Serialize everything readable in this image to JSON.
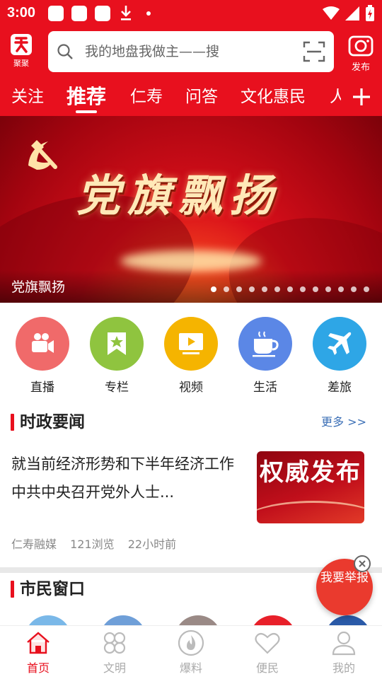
{
  "status_bar": {
    "time": "3:00"
  },
  "header": {
    "logo_label": "聚聚",
    "search_placeholder": "我的地盘我做主——搜",
    "publish_label": "发布"
  },
  "tabs": [
    {
      "label": "关注",
      "active": false
    },
    {
      "label": "推荐",
      "active": true
    },
    {
      "label": "仁寿",
      "active": false
    },
    {
      "label": "问答",
      "active": false
    },
    {
      "label": "文化惠民",
      "active": false
    },
    {
      "label": "人",
      "active": false
    }
  ],
  "banner": {
    "title": "党旗飘扬",
    "caption": "党旗飘扬",
    "slide_count": 13,
    "active_slide": 1
  },
  "quick_links": [
    {
      "label": "直播",
      "icon": "video-camera-icon",
      "color": "#f06a6a"
    },
    {
      "label": "专栏",
      "icon": "bookmark-star-icon",
      "color": "#8fc43f"
    },
    {
      "label": "视频",
      "icon": "play-screen-icon",
      "color": "#f5b400"
    },
    {
      "label": "生活",
      "icon": "coffee-cup-icon",
      "color": "#5b87e6"
    },
    {
      "label": "差旅",
      "icon": "airplane-icon",
      "color": "#2ea6e6"
    }
  ],
  "section_news": {
    "title": "时政要闻",
    "more": "更多 >>",
    "article": {
      "title": "就当前经济形势和下半年经济工作 中共中央召开党外人士...",
      "thumb_text": "权威发布",
      "source": "仁寿融媒",
      "views": "121浏览",
      "time": "22小时前"
    }
  },
  "section_civic": {
    "title": "市民窗口",
    "more": ">"
  },
  "report_button": "我要举报",
  "bottom_nav": [
    {
      "label": "首页",
      "icon": "home-icon",
      "active": true
    },
    {
      "label": "文明",
      "icon": "clover-icon",
      "active": false
    },
    {
      "label": "爆料",
      "icon": "flame-icon",
      "active": false
    },
    {
      "label": "便民",
      "icon": "heart-icon",
      "active": false
    },
    {
      "label": "我的",
      "icon": "user-icon",
      "active": false
    }
  ],
  "colors": {
    "brand_red": "#e8101e",
    "link_blue": "#3b6fb6"
  }
}
